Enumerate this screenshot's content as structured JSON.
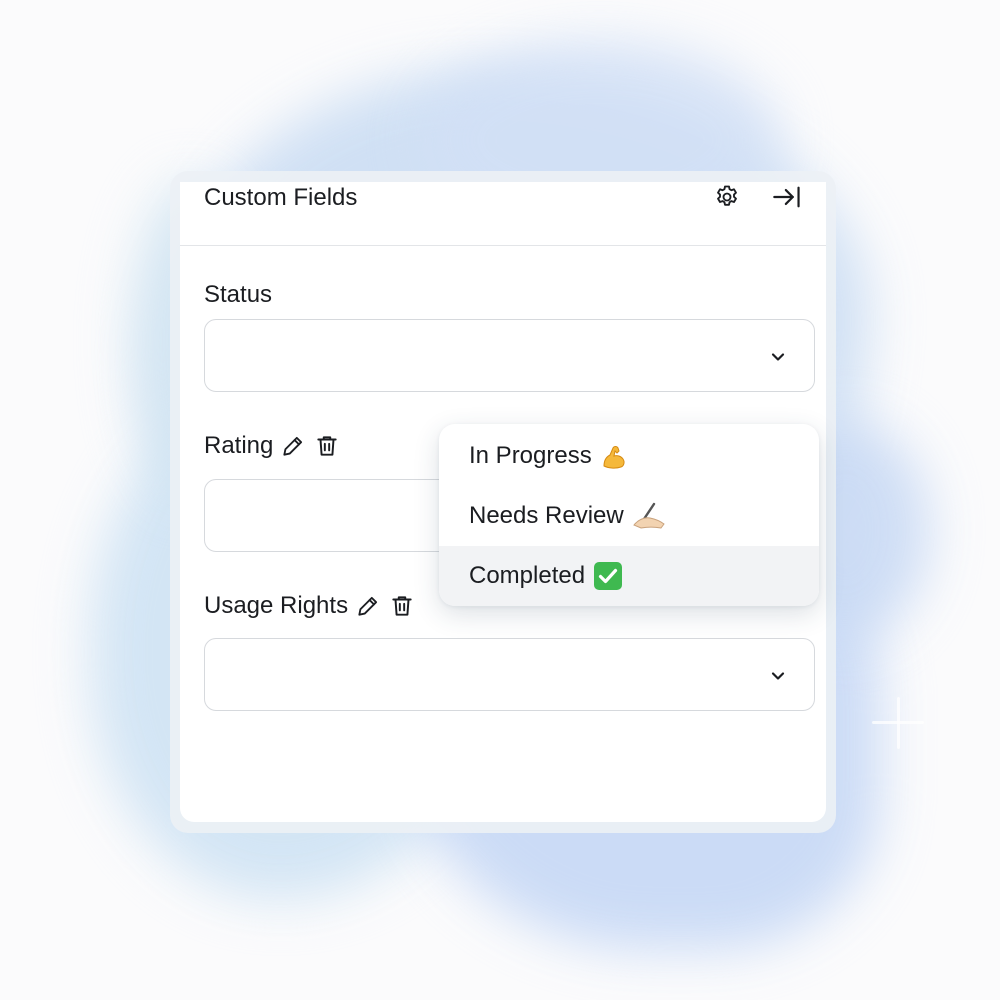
{
  "panel": {
    "title": "Custom Fields",
    "header_icons": [
      "gear-icon",
      "collapse-right-icon"
    ]
  },
  "fields": [
    {
      "label": "Status",
      "value": "",
      "control": "select"
    },
    {
      "label": "Rating",
      "value": "",
      "control": "select",
      "icons": [
        "pencil-icon",
        "trash-icon"
      ]
    },
    {
      "label": "Usage Rights",
      "value": "",
      "control": "select",
      "icons": [
        "pencil-icon",
        "trash-icon"
      ]
    }
  ],
  "dropdown": {
    "options": [
      {
        "label": "In Progress",
        "emoji": "flexed-biceps"
      },
      {
        "label": "Needs Review",
        "emoji": "writing-hand"
      },
      {
        "label": "Completed",
        "emoji": "check-mark-button",
        "highlighted": true
      }
    ]
  },
  "colors": {
    "text": "#1b1d21",
    "border": "#d6d9dd",
    "highlight": "#f2f3f5",
    "check_green": "#3fb950",
    "background_wash": "#c9dcf3"
  }
}
